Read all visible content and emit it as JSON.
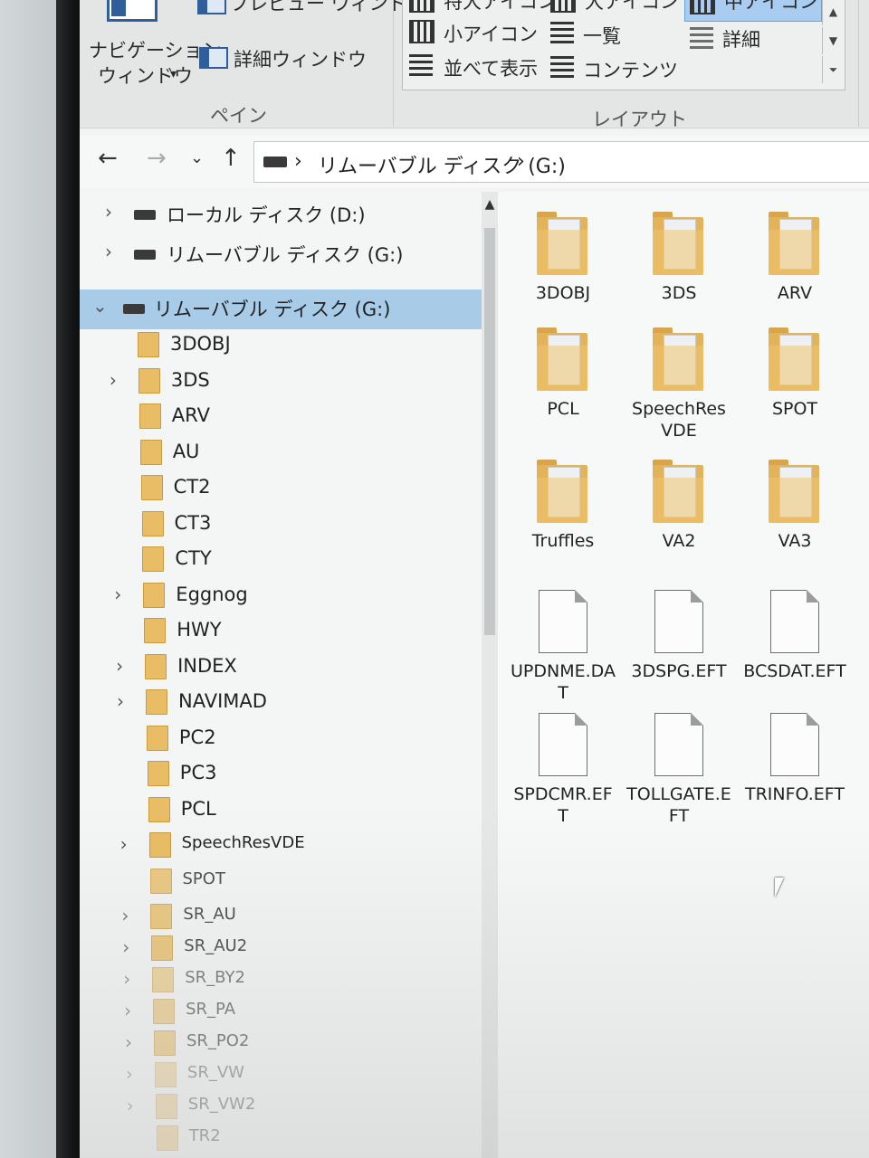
{
  "ribbon": {
    "pane_group": {
      "preview_window": "プレビュー ウィンドウ",
      "nav_window_line1": "ナビゲーション",
      "nav_window_line2": "ウィンドウ",
      "details_window": "詳細ウィンドウ",
      "label": "ペイン"
    },
    "layout_group": {
      "extra_large_icons": "特大アイコン",
      "large_icons": "大アイコン",
      "medium_icons": "中アイコン",
      "small_icons": "小アイコン",
      "list": "一覧",
      "details": "詳細",
      "tiles": "並べて表示",
      "content": "コンテンツ",
      "label": "レイアウト"
    }
  },
  "address_bar": {
    "separator": "›",
    "location": "リムーバブル ディスク (G:)",
    "trailing": "›"
  },
  "nav_pane": {
    "drives": [
      {
        "label": "ローカル ディスク (D:)"
      },
      {
        "label": "リムーバブル ディスク (G:)"
      },
      {
        "label": "リムーバブル ディスク (G:)",
        "selected": true
      }
    ],
    "folders": [
      {
        "label": "3DOBJ",
        "expandable": false
      },
      {
        "label": "3DS",
        "expandable": true
      },
      {
        "label": "ARV",
        "expandable": false
      },
      {
        "label": "AU",
        "expandable": false
      },
      {
        "label": "CT2",
        "expandable": false
      },
      {
        "label": "CT3",
        "expandable": false
      },
      {
        "label": "CTY",
        "expandable": false
      },
      {
        "label": "Eggnog",
        "expandable": true
      },
      {
        "label": "HWY",
        "expandable": false
      },
      {
        "label": "INDEX",
        "expandable": true
      },
      {
        "label": "NAVIMAD",
        "expandable": true
      },
      {
        "label": "PC2",
        "expandable": false
      },
      {
        "label": "PC3",
        "expandable": false
      },
      {
        "label": "PCL",
        "expandable": false
      },
      {
        "label": "SpeechResVDE",
        "expandable": true
      },
      {
        "label": "SPOT",
        "expandable": false
      },
      {
        "label": "SR_AU",
        "expandable": true
      },
      {
        "label": "SR_AU2",
        "expandable": true
      },
      {
        "label": "SR_BY2",
        "expandable": true
      },
      {
        "label": "SR_PA",
        "expandable": true
      },
      {
        "label": "SR_PO2",
        "expandable": true
      },
      {
        "label": "SR_VW",
        "expandable": true
      },
      {
        "label": "SR_VW2",
        "expandable": true
      },
      {
        "label": "TR2",
        "expandable": false
      }
    ]
  },
  "content": {
    "items": [
      {
        "name": "3DOBJ",
        "type": "folder"
      },
      {
        "name": "3DS",
        "type": "folder"
      },
      {
        "name": "ARV",
        "type": "folder"
      },
      {
        "name": "PCL",
        "type": "folder"
      },
      {
        "name": "SpeechRes VDE",
        "type": "folder"
      },
      {
        "name": "SPOT",
        "type": "folder"
      },
      {
        "name": "Truffles",
        "type": "folder"
      },
      {
        "name": "VA2",
        "type": "folder"
      },
      {
        "name": "VA3",
        "type": "folder"
      },
      {
        "name": "UPDNME.DAT",
        "type": "file"
      },
      {
        "name": "3DSPG.EFT",
        "type": "file"
      },
      {
        "name": "BCSDAT.EFT",
        "type": "file"
      },
      {
        "name": "SPDCMR.EFT",
        "type": "file"
      },
      {
        "name": "TOLLGATE.EFT",
        "type": "file"
      },
      {
        "name": "TRINFO.EFT",
        "type": "file"
      }
    ]
  },
  "colors": {
    "selection": "#a8cce8",
    "folder": "#e3b35a",
    "accent": "#2f5f9a"
  }
}
